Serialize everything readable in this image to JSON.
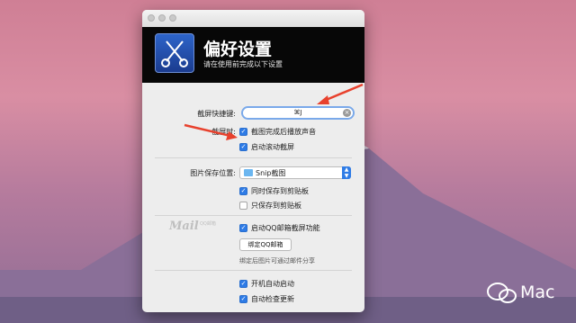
{
  "window": {
    "title": "偏好设置",
    "subtitle": "请在使用前完成以下设置"
  },
  "shortcut": {
    "label": "截屏快捷键:",
    "value": "⌘J"
  },
  "capture": {
    "label": "截屏时:",
    "options": [
      {
        "label": "截图完成后播放声音",
        "checked": true
      },
      {
        "label": "启动滚动截屏",
        "checked": true
      }
    ]
  },
  "save": {
    "label": "图片保存位置:",
    "folder": "Snip截图",
    "options": [
      {
        "label": "同时保存到剪贴板",
        "checked": true
      },
      {
        "label": "只保存到剪贴板",
        "checked": false
      }
    ]
  },
  "mail": {
    "logo_text": "Mail",
    "logo_sub": "QQ邮箱",
    "option": {
      "label": "启动QQ邮箱截屏功能",
      "checked": true
    },
    "bind_button": "绑定QQ邮箱",
    "hint": "绑定后图片可通过邮件分享"
  },
  "startup": {
    "options": [
      {
        "label": "开机自动启动",
        "checked": true
      },
      {
        "label": "自动检查更新",
        "checked": true
      }
    ]
  },
  "watermark": {
    "text": "Mac"
  },
  "colors": {
    "accent": "#2e7be6",
    "arrow": "#e8412d"
  }
}
